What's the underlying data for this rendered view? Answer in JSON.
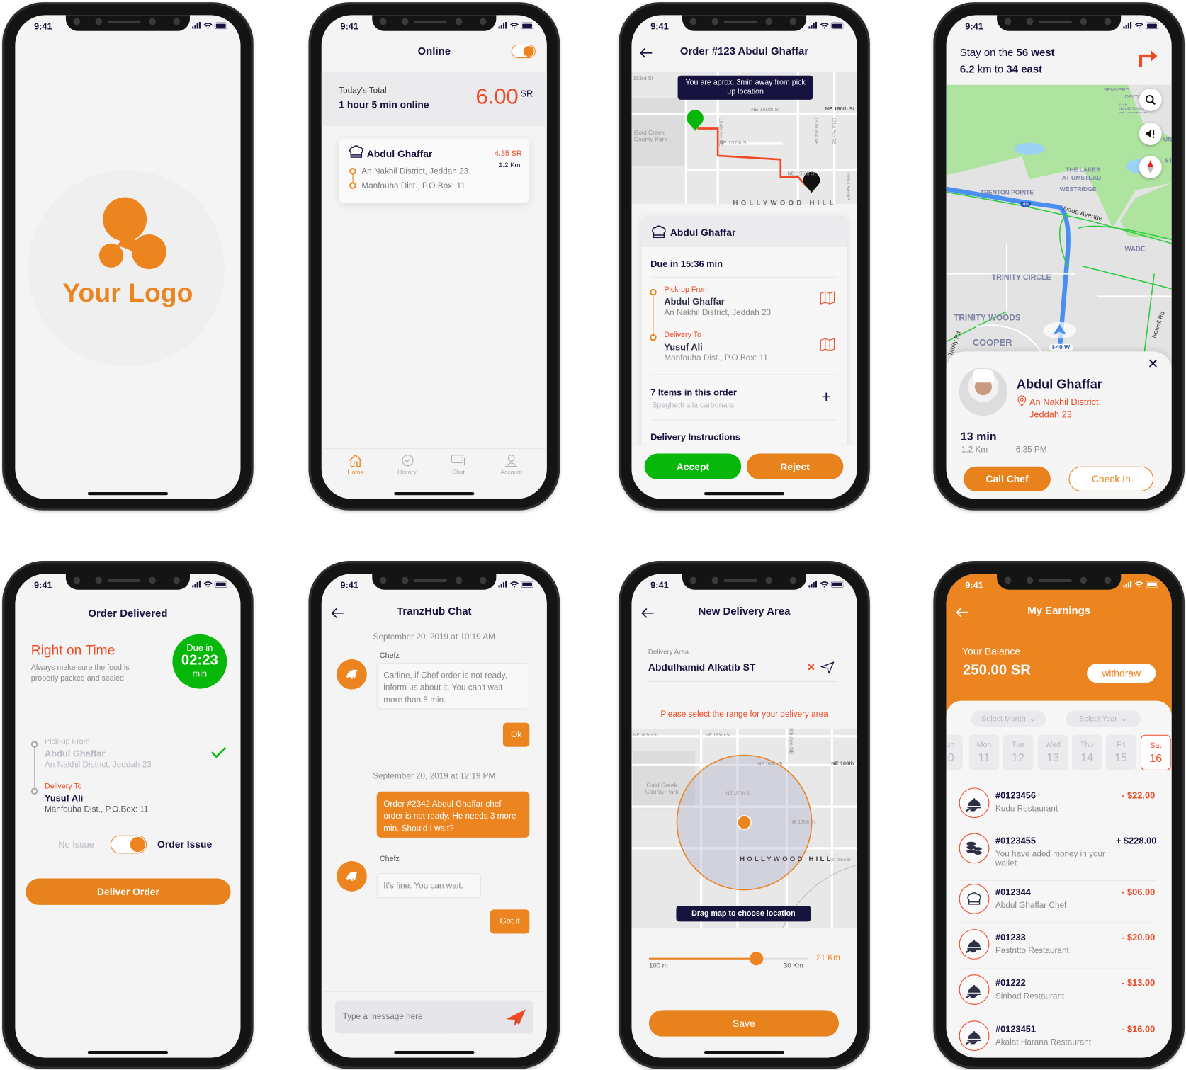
{
  "colors": {
    "accent": "#ec8420",
    "danger": "#ee4a25",
    "navy": "#16133f",
    "success": "#07b80a"
  },
  "status": {
    "time": "9:41"
  },
  "splash": {
    "logo_text": "Your Logo"
  },
  "home": {
    "header": {
      "title": "Online",
      "online_toggle": true
    },
    "summary": {
      "label": "Today's Total",
      "online_time": "1 hour 5 min online",
      "amount": "6.00",
      "currency": "SR"
    },
    "order_card": {
      "name": "Abdul Ghaffar",
      "price": "4.35 SR",
      "distance": "1.2 Km",
      "pickup": "An Nakhil District, Jeddah 23",
      "dropoff": "Manfouha Dist., P.O.Box: 11"
    },
    "tabs": [
      {
        "label": "Home",
        "icon": "home-icon",
        "active": true
      },
      {
        "label": "History",
        "icon": "history-icon"
      },
      {
        "label": "Chat",
        "icon": "chat-icon"
      },
      {
        "label": "Account",
        "icon": "account-icon"
      }
    ]
  },
  "order": {
    "title": "Order #123 Abdul Ghaffar",
    "map_notice": "You are aprox. 3min away from pick up location",
    "map_labels": [
      "163rd St",
      "NE 160th St",
      "NE 160th St",
      "Gold Creek County Park",
      "NE 157th St",
      "NE 155th St",
      "154th Ave NE",
      "160th Ave NE",
      "161st Ave NE",
      "163rd Ave NE",
      "HOLLYWOOD HILL"
    ],
    "chef_name": "Abdul Ghaffar",
    "due": "Due in 15:36 min",
    "pickup": {
      "label": "Pick-up From",
      "name": "Abdul Ghaffar",
      "address": "An Nakhil District, Jeddah 23"
    },
    "delivery": {
      "label": "Delivery To",
      "name": "Yusuf Ali",
      "address": "Manfouha Dist., P.O.Box: 11"
    },
    "items": {
      "title": "7 Items in this order",
      "subtitle": "Spaghetti alla carbonara"
    },
    "instructions_title": "Delivery Instructions",
    "accept": "Accept",
    "reject": "Reject"
  },
  "navigation": {
    "instruction_prefix": "Stay on the ",
    "instruction_road": "56 west",
    "distance": "6.2",
    "distance_mid": " km to ",
    "distance_road": "34 east",
    "map_labels": [
      "SENDERO",
      "DELTA",
      "THE HAMPTONS AT UMSTEAD",
      "THE LAKES",
      "AT UMSTEAD",
      "WESTRIDGE",
      "TRENTON POINTE",
      "40",
      "Wade Avenue",
      "WADE",
      "TRINITY CIRCLE",
      "TRINITY WOODS",
      "COOPER",
      "I-40 W",
      "Nowell Rd",
      "Trinity Rd",
      "UN",
      "ST"
    ],
    "chef": {
      "name": "Abdul Ghaffar",
      "address_line1": "An Nakhil District,",
      "address_line2": "Jeddah 23"
    },
    "eta": "13 min",
    "distance_short": "1.2 Km",
    "arrival": "6:35 PM",
    "call": "Call Chef",
    "checkin": "Check In"
  },
  "delivered": {
    "title": "Order Delivered",
    "headline": "Right on Time",
    "description_line1": "Always make sure the food is",
    "description_line2": "properly packed and sealed.",
    "timer": {
      "label": "Due in",
      "value": "02:23",
      "unit": "min"
    },
    "pickup": {
      "label": "Pick-up From",
      "name": "Abdul Ghaffar",
      "address": "An Nakhil District, Jeddah 23",
      "done": true
    },
    "delivery": {
      "label": "Delivery To",
      "name": "Yusuf Ali",
      "address": "Manfouha Dist., P.O.Box: 11"
    },
    "issue_off": "No Issue",
    "issue_on": "Order Issue",
    "issue_toggle": true,
    "button": "Deliver Order"
  },
  "chat": {
    "title": "TranzHub Chat",
    "messages": [
      {
        "date": "September 20, 2019 at 10:19 AM"
      },
      {
        "sender": "Chefz",
        "text": "Carline, if Chef order is not ready, inform us about it. You can't wait more than 5 min."
      },
      {
        "quick_reply": "Ok"
      },
      {
        "date": "September 20, 2019 at 12:19 PM"
      },
      {
        "text": "Order #2342 Abdul Ghaffar chef order is not ready. He needs 3 more min. Should I wait?"
      },
      {
        "sender": "Chefz",
        "text": "It's fine. You can wait."
      },
      {
        "quick_reply": "Got it"
      }
    ],
    "input_placeholder": "Type a message here"
  },
  "area": {
    "title": "New Delivery Area",
    "field_label": "Delivery Area",
    "field_value": "Abdulhamid Alkatib ST",
    "prompt": "Please select the range for your delivery area",
    "map_labels": [
      "NE 163rd St",
      "NE 163rd St",
      "8th Ave NE",
      "NE 160th St",
      "NE 160th",
      "Gold Creek County Park",
      "NE 157th St",
      "NE 155th St",
      "HOLLYWOOD HILL",
      "NE 153rd St"
    ],
    "map_hint": "Drag map to choose location",
    "range": {
      "min_label": "100 m",
      "max_label": "30 Km",
      "value_label": "21 Km",
      "value_km": 21,
      "min_km": 0.1,
      "max_km": 30
    },
    "save": "Save"
  },
  "earnings": {
    "title": "My Earnings",
    "balance_label": "Your Balance",
    "balance": "250.00 SR",
    "withdraw": "withdraw",
    "select_month": "Select Month",
    "select_year": "Select Year",
    "days": [
      {
        "d": "Sun",
        "n": "10"
      },
      {
        "d": "Mon",
        "n": "11"
      },
      {
        "d": "Tue",
        "n": "12"
      },
      {
        "d": "Wed",
        "n": "13"
      },
      {
        "d": "Thu",
        "n": "14"
      },
      {
        "d": "Fri",
        "n": "15"
      },
      {
        "d": "Sat",
        "n": "16",
        "selected": true
      }
    ],
    "transactions": [
      {
        "id": "#0123456",
        "desc": "Kudu Restaurant",
        "amount": "- $22.00",
        "icon": "cloche-icon"
      },
      {
        "id": "#0123455",
        "desc": "You have aded money in your wallet",
        "amount": "+ $228.00",
        "icon": "coins-icon"
      },
      {
        "id": "#012344",
        "desc": "Abdul Ghaffar Chef",
        "amount": "- $06.00",
        "icon": "chef-hat-icon"
      },
      {
        "id": "#01233",
        "desc": "Pastritto Restaurant",
        "amount": "- $20.00",
        "icon": "cloche-icon"
      },
      {
        "id": "#01222",
        "desc": "Sinbad Restaurant",
        "amount": "- $13.00",
        "icon": "cloche-icon"
      },
      {
        "id": "#0123451",
        "desc": "Akalat Harana Restaurant",
        "amount": "- $16.00",
        "icon": "cloche-icon"
      }
    ]
  }
}
